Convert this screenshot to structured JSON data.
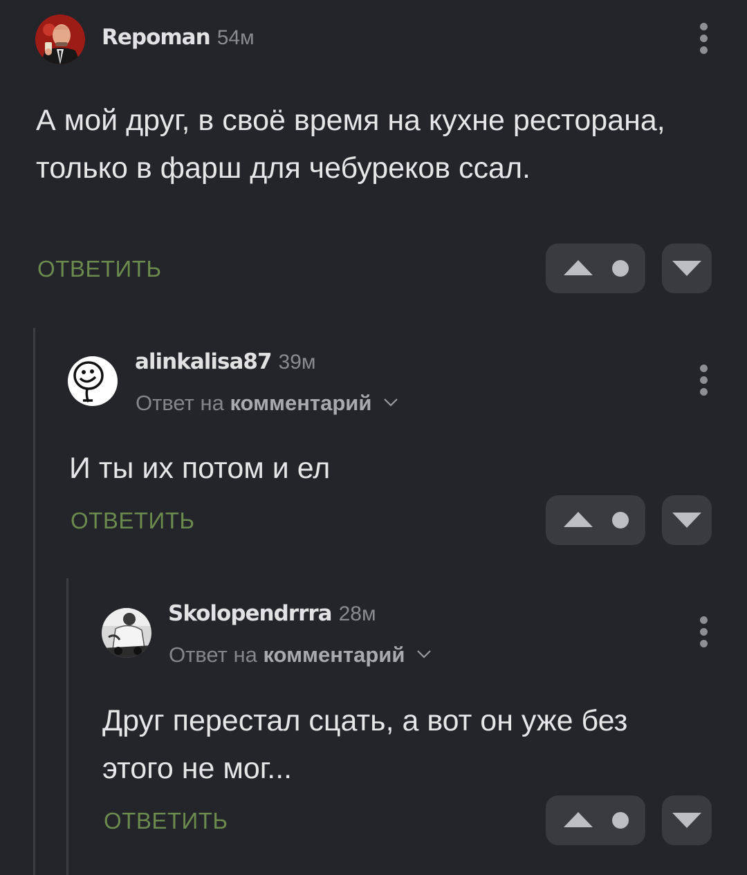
{
  "comments": [
    {
      "username": "Repoman",
      "time": "54м",
      "text": "А мой друг, в своё время на кухне ресторана, только в фарш для чебуреков ссал.",
      "reply_label": "ОТВЕТИТЬ",
      "avatar": "man-in-suit-avatar"
    },
    {
      "username": "alinkalisa87",
      "time": "39м",
      "reply_to_prefix": "Ответ на",
      "reply_to_target": "комментарий",
      "text": "И ты их потом и ел",
      "reply_label": "ОТВЕТИТЬ",
      "avatar": "meme-face-avatar"
    },
    {
      "username": "Skolopendrrra",
      "time": "28м",
      "reply_to_prefix": "Ответ на",
      "reply_to_target": "комментарий",
      "text": "Друг перестал сцать, а вот он уже без этого не мог...",
      "reply_label": "ОТВЕТИТЬ",
      "avatar": "bw-photo-avatar"
    }
  ],
  "icons": {
    "more": "more-vertical-icon",
    "upvote": "upvote-triangle-icon",
    "rating": "rating-dot-icon",
    "downvote": "downvote-triangle-icon",
    "chevron": "chevron-down-icon"
  },
  "colors": {
    "background": "#24252a",
    "reply_green": "#6b8a4e",
    "vote_button": "#3a3b40"
  }
}
